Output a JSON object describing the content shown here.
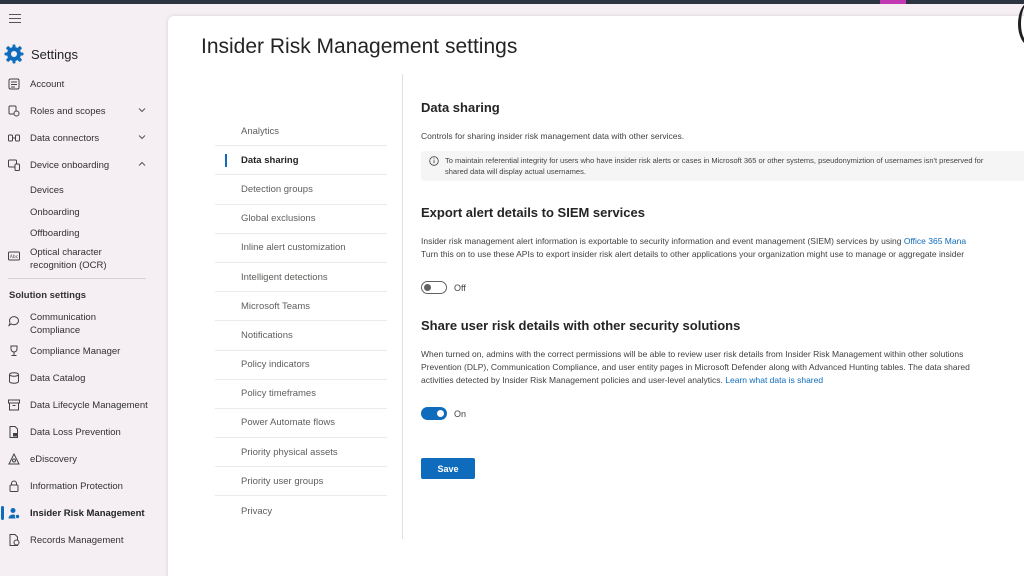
{
  "leftnav": {
    "title": "Settings",
    "items": [
      {
        "label": "Account",
        "icon": "account-icon"
      },
      {
        "label": "Roles and scopes",
        "icon": "roles-icon",
        "chevron": "down"
      },
      {
        "label": "Data connectors",
        "icon": "connectors-icon",
        "chevron": "down"
      },
      {
        "label": "Device onboarding",
        "icon": "device-icon",
        "chevron": "up"
      }
    ],
    "device_sub": [
      "Devices",
      "Onboarding",
      "Offboarding"
    ],
    "ocr": {
      "label_line1": "Optical character",
      "label_line2": "recognition (OCR)"
    },
    "solution_header": "Solution settings",
    "solutions": [
      {
        "label_line1": "Communication",
        "label_line2": "Compliance"
      },
      {
        "label": "Compliance Manager"
      },
      {
        "label": "Data Catalog"
      },
      {
        "label": "Data Lifecycle Management"
      },
      {
        "label": "Data Loss Prevention"
      },
      {
        "label": "eDiscovery"
      },
      {
        "label": "Information Protection"
      },
      {
        "label": "Insider Risk Management",
        "active": true
      },
      {
        "label": "Records Management"
      }
    ]
  },
  "page": {
    "title": "Insider Risk Management settings"
  },
  "subnav": [
    "Analytics",
    "Data sharing",
    "Detection groups",
    "Global exclusions",
    "Inline alert customization",
    "Intelligent detections",
    "Microsoft Teams",
    "Notifications",
    "Policy indicators",
    "Policy timeframes",
    "Power Automate flows",
    "Priority physical assets",
    "Priority user groups",
    "Privacy"
  ],
  "subnav_active": "Data sharing",
  "data_sharing": {
    "heading": "Data sharing",
    "description": "Controls for sharing insider risk management data with other services.",
    "info_line1": "To maintain referential integrity for users who have insider risk alerts or cases in Microsoft 365 or other systems, pseudonymiztion of usernames isn't preserved for",
    "info_line2": "shared data will display actual usernames."
  },
  "siem": {
    "heading": "Export alert details to SIEM services",
    "line1_prefix": "Insider risk management alert information is exportable to security information and event management (SIEM) services by using ",
    "line1_link": "Office 365 Mana",
    "line2": "Turn this on to use these APIs to export insider risk alert details to other applications your organization might use to manage or aggregate insider",
    "toggle_state": "Off"
  },
  "share_risk": {
    "heading": "Share user risk details with other security solutions",
    "line1": "When turned on, admins with the correct permissions will be able to review user risk details from Insider Risk Management within other solutions",
    "line2": "Prevention (DLP), Communication Compliance, and user entity pages in Microsoft Defender along with Advanced Hunting tables. The data shared",
    "line3_prefix": "activities detected by Insider Risk Management policies and user-level analytics. ",
    "line3_link": "Learn what data is shared",
    "toggle_state": "On"
  },
  "actions": {
    "save_label": "Save"
  },
  "colors": {
    "accent": "#0f6cbd",
    "nav_bg": "#f5eff3",
    "topbar": "#2b3440"
  }
}
